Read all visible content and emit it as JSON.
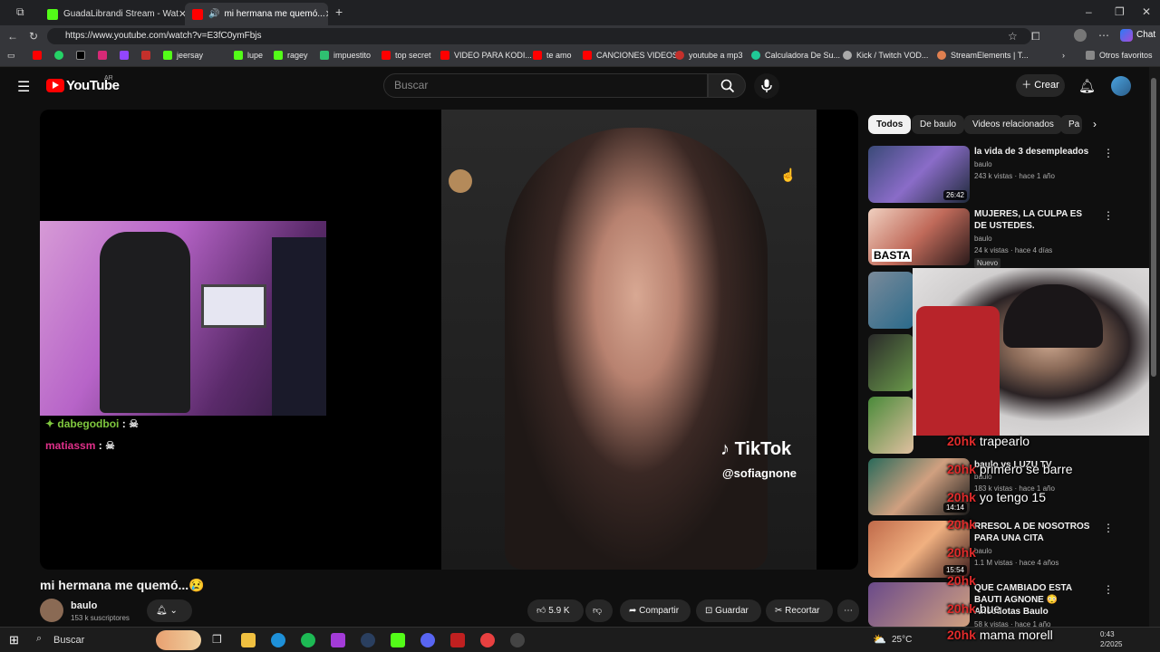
{
  "browser": {
    "tabs": [
      {
        "label": "GuadaLibrandi Stream - Wat",
        "active": false
      },
      {
        "label": "mi hermana me quemó...",
        "active": true
      }
    ],
    "url": "https://www.youtube.com/watch?v=E3fC0ymFbjs",
    "chat_label": "Chat",
    "bookmarks": [
      "jeersay",
      "lupe",
      "ragey",
      "impuestito",
      "top secret",
      "VIDEO PARA KODI...",
      "te amo",
      "CANCIONES VIDEOS",
      "youtube a mp3",
      "Calculadora De Su...",
      "Kick / Twitch VOD...",
      "StreamElements | T...",
      "Otros favoritos"
    ]
  },
  "youtube": {
    "logo": "YouTube",
    "region": "AR",
    "search_placeholder": "Buscar",
    "create_label": "Crear"
  },
  "video": {
    "chat": [
      {
        "user": "dabegodboi",
        "msg": ":"
      },
      {
        "user": "matiassm",
        "msg": ":"
      }
    ],
    "tiktok_brand": "TikTok",
    "tiktok_handle": "@sofiagnone",
    "title": "mi hermana me quemó...😢",
    "channel": "baulo",
    "subscribers": "153 k suscriptores",
    "likes": "5.9 K",
    "share_label": "Compartir",
    "save_label": "Guardar",
    "clip_label": "Recortar"
  },
  "sidebar": {
    "chips": [
      "Todos",
      "De baulo",
      "Videos relacionados",
      "Pa"
    ],
    "items": [
      {
        "title": "la vida de 3 desempleados",
        "channel": "baulo",
        "meta": "243 k vistas · hace 1 año",
        "duration": "26:42"
      },
      {
        "title": "MUJERES, LA CULPA ES DE USTEDES.",
        "channel": "baulo",
        "meta": "24 k vistas · hace 4 días",
        "badge": "Nuevo",
        "duration": ""
      },
      {
        "title": "baulo vs LUZU TV",
        "channel": "baulo",
        "meta": "183 k vistas · hace 1 año",
        "duration": "14:14"
      },
      {
        "title": "RRESOL A DE NOSOTROS PARA UNA CITA",
        "channel": "baulo",
        "meta": "1.1 M vistas · hace 4 años",
        "duration": "15:54"
      },
      {
        "title": "QUE CAMBIADO ESTA BAUTI AGNONE 😳 Anécdotas Baulo",
        "channel": "baulo",
        "meta": "58 k vistas · hace 1 año",
        "duration": ""
      }
    ]
  },
  "overlay_chat": [
    {
      "user": "20hk",
      "msg": "trapearlo"
    },
    {
      "user": "20hk",
      "msg": "primero se barre"
    },
    {
      "user": "20hk",
      "msg": "yo tengo 15"
    },
    {
      "user": "20hk",
      "msg": ""
    },
    {
      "user": "20hk",
      "msg": ""
    },
    {
      "user": "20hk",
      "msg": ""
    },
    {
      "user": "20hk",
      "msg": "bue"
    },
    {
      "user": "20hk",
      "msg": "mama morell"
    }
  ],
  "taskbar": {
    "search_placeholder": "Buscar",
    "temperature": "25°C",
    "time": "0:43",
    "date": "2/2025"
  },
  "colors": {
    "yt_red": "#ff0000",
    "bg": "#0f0f0f",
    "chip_active": "#f1f1f1"
  }
}
